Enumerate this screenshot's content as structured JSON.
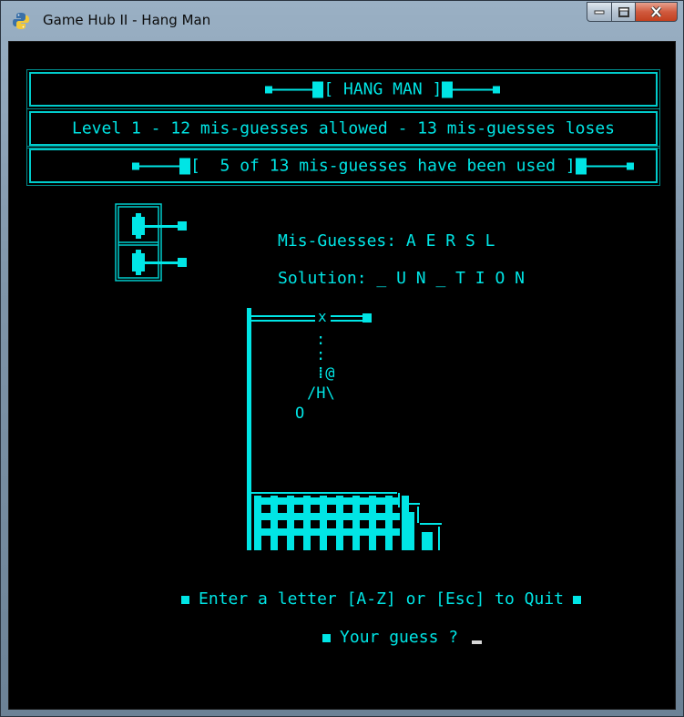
{
  "window": {
    "title": "Game Hub II - Hang Man",
    "icon": "python-icon",
    "buttons": [
      "minimize-icon",
      "maximize-icon",
      "close-icon"
    ]
  },
  "colors": {
    "console_fg": "#00e5e5",
    "console_bg": "#000000",
    "cursor": "#d8d8d8"
  },
  "header": {
    "title": "[ HANG MAN ]",
    "level_info": "Level 1 - 12 mis-guesses allowed - 13 mis-guesses loses",
    "used_info": "[  5 of 13 mis-guesses have been used ]"
  },
  "status": {
    "misguesses_label": "Mis-Guesses:",
    "misguesses_value": "A E R S L",
    "solution_label": "Solution:",
    "solution_value": "_ U N _ T I O N"
  },
  "gallows": {
    "rope": [
      ":",
      ":",
      ":"
    ],
    "head": ":@",
    "body": "/H\\",
    "foot": "O"
  },
  "prompt": {
    "instruction": "Enter a letter [A-Z] or [Esc] to Quit",
    "guess_label": "Your guess ?",
    "guess_value": ""
  }
}
